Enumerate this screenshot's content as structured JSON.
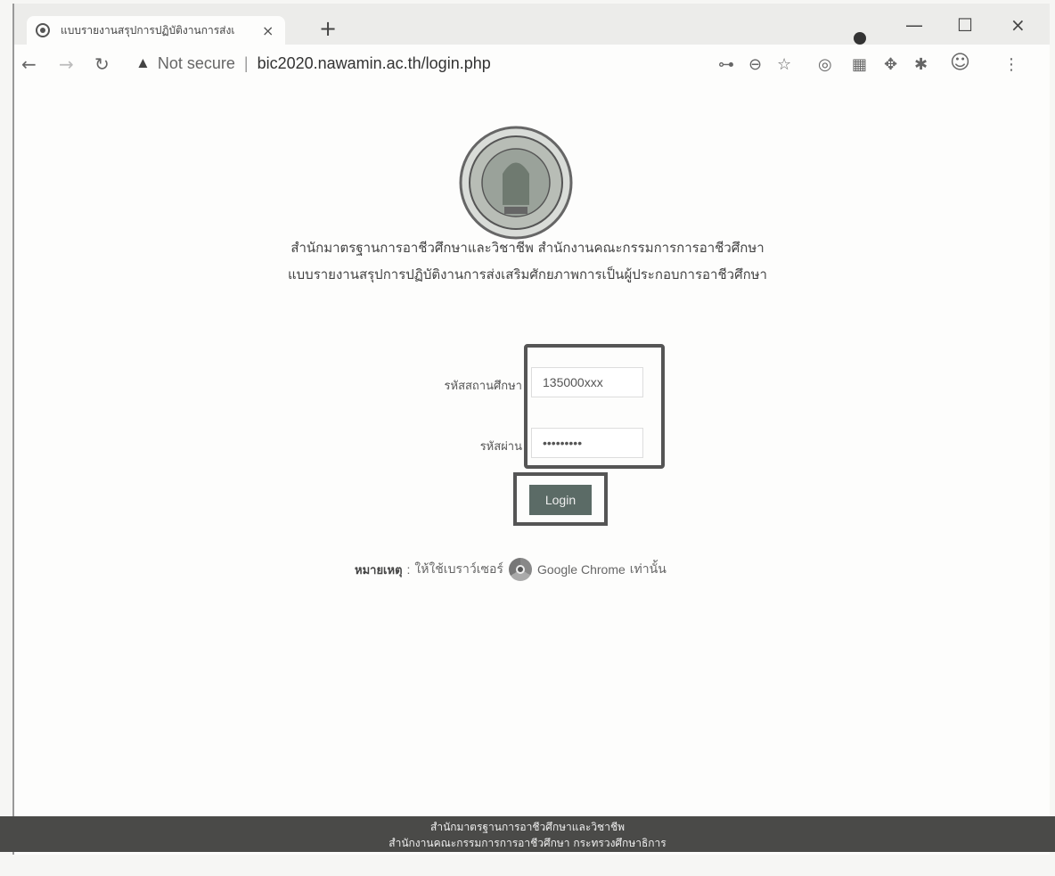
{
  "browser": {
    "tab_title": "แบบรายงานสรุปการปฏิบัติงานการส่งเ",
    "tab_close": "×",
    "new_tab": "+",
    "minimize": "—",
    "maximize": "☐",
    "close": "×",
    "security_label": "Not secure",
    "url": "bic2020.nawamin.ac.th/login.php"
  },
  "header": {
    "line1": "สำนักมาตรฐานการอาชีวศึกษาและวิชาชีพ สำนักงานคณะกรรมการการอาชีวศึกษา",
    "line2": "แบบรายงานสรุปการปฏิบัติงานการส่งเสริมศักยภาพการเป็นผู้ประกอบการอาชีวศึกษา"
  },
  "form": {
    "institution_label": "รหัสสถานศึกษา",
    "institution_value": "135000xxx",
    "password_label": "รหัสผ่าน",
    "password_value": "•••••••••",
    "login_label": "Login"
  },
  "note": {
    "label": "หมายเหตุ",
    "separator": ":",
    "text_before": "ให้ใช้เบราว์เซอร์",
    "browser_name": "Google Chrome",
    "text_after": "เท่านั้น"
  },
  "footer": {
    "line1": "สำนักมาตรฐานการอาชีวศึกษาและวิชาชีพ",
    "line2": "สำนักงานคณะกรรมการการอาชีวศึกษา กระทรวงศึกษาธิการ"
  }
}
